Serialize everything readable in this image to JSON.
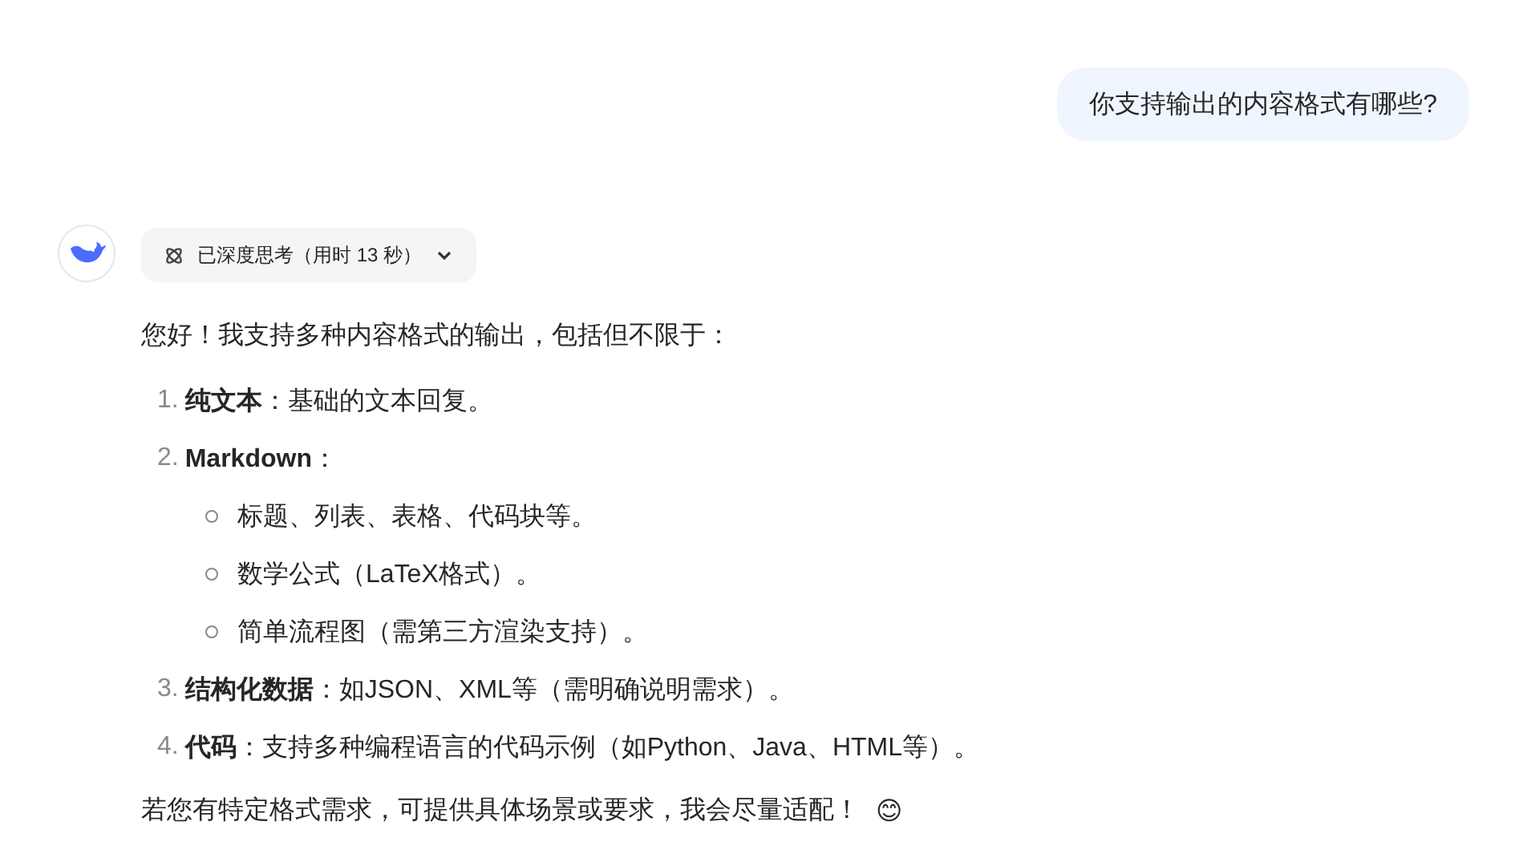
{
  "user_message": {
    "text": "你支持输出的内容格式有哪些?"
  },
  "reply": {
    "thinking": {
      "label": "已深度思考（用时 13 秒）",
      "expanded": false
    },
    "intro": "您好！我支持多种内容格式的输出，包括但不限于：",
    "items": [
      {
        "number": "1.",
        "text": "**纯文本**：基础的文本回复。"
      },
      {
        "number": "2.",
        "text": "**Markdown**：",
        "children": [
          {
            "text": "标题、列表、表格、代码块等。"
          },
          {
            "text": "数学公式（LaTeX格式）。"
          },
          {
            "text": "简单流程图（需第三方渲染支持）。"
          }
        ]
      },
      {
        "number": "3.",
        "text": "**结构化数据**：如JSON、XML等（需明确说明需求）。"
      },
      {
        "number": "4.",
        "text": "**代码**：支持多种编程语言的代码示例（如Python、Java、HTML等）。"
      }
    ],
    "closing": "若您有特定格式需求，可提供具体场景或要求，我会尽量适配！",
    "emoji": "😊"
  }
}
